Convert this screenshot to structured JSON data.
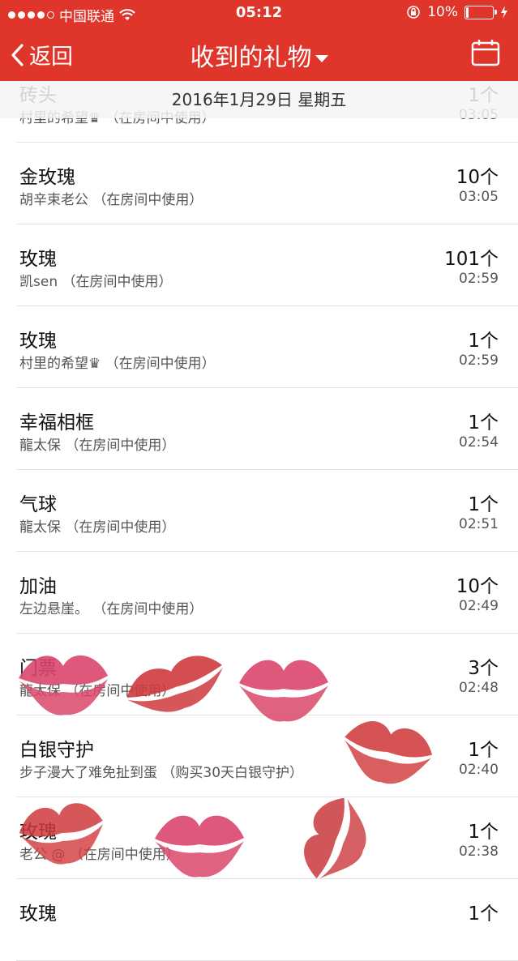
{
  "status_bar": {
    "carrier": "中国联通",
    "time": "05:12",
    "battery": "10%",
    "battery_level": 0.1
  },
  "nav": {
    "back_label": "返回",
    "title": "收到的礼物"
  },
  "date_header": "2016年1月29日 星期五",
  "items": [
    {
      "name": "砖头",
      "sub": "村里的希望♛  （在房间中使用）",
      "count": "1个",
      "time": "03:05"
    },
    {
      "name": "金玫瑰",
      "sub": "胡辛束老公  （在房间中使用）",
      "count": "10个",
      "time": "03:05"
    },
    {
      "name": "玫瑰",
      "sub": "凯sen  （在房间中使用）",
      "count": "101个",
      "time": "02:59"
    },
    {
      "name": "玫瑰",
      "sub": "村里的希望♛  （在房间中使用）",
      "count": "1个",
      "time": "02:59"
    },
    {
      "name": "幸福相框",
      "sub": "龍太保  （在房间中使用）",
      "count": "1个",
      "time": "02:54"
    },
    {
      "name": "气球",
      "sub": "龍太保  （在房间中使用）",
      "count": "1个",
      "time": "02:51"
    },
    {
      "name": "加油",
      "sub": "左边悬崖。  （在房间中使用）",
      "count": "10个",
      "time": "02:49"
    },
    {
      "name": "门票",
      "sub": "龍太保  （在房间中使用）",
      "count": "3个",
      "time": "02:48"
    },
    {
      "name": "白银守护",
      "sub": "步子漫大了难免扯到蛋  （购买30天白银守护）",
      "count": "1个",
      "time": "02:40"
    },
    {
      "name": "玫瑰",
      "sub": "老公 @  （在房间中使用）",
      "count": "1个",
      "time": "02:38"
    },
    {
      "name": "玫瑰",
      "sub": "",
      "count": "1个",
      "time": ""
    }
  ],
  "colors": {
    "brand_red": "#e0352b",
    "kiss_pink": "#d9466b",
    "kiss_red": "#c9383d"
  }
}
